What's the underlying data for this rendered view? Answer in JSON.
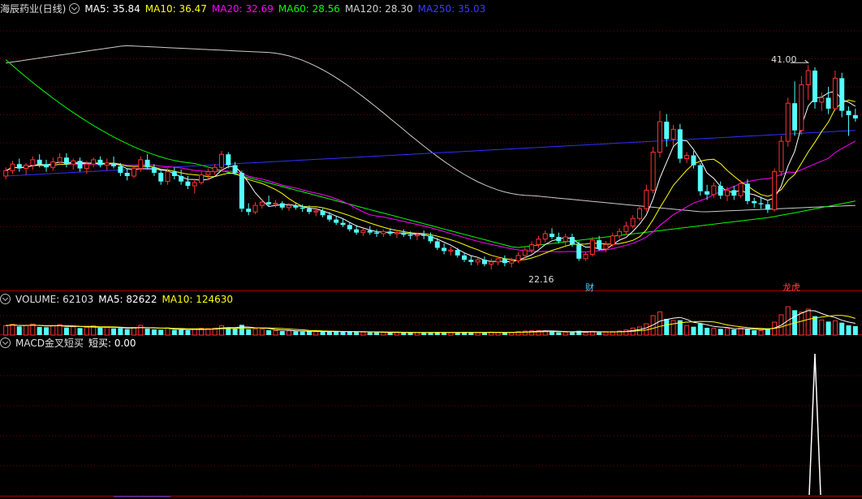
{
  "header": {
    "title": "海辰药业(日线)",
    "ma5": "MA5: 35.84",
    "ma10": "MA10: 36.47",
    "ma20": "MA20: 32.69",
    "ma60": "MA60: 28.56",
    "ma120": "MA120: 28.30",
    "ma250": "MA250: 35.03"
  },
  "volume_header": {
    "title": "VOLUME: 62103",
    "ma5": "MA5: 82622",
    "ma10": "MA10: 124630"
  },
  "macd_header": {
    "title": "MACD金叉短买",
    "value": "短买: 0.00"
  },
  "annotations": {
    "max_price": "41.00",
    "min_price": "22.16",
    "cai": "财",
    "long_hu": "龙虎"
  },
  "colors": {
    "up": "#ff3232",
    "down": "#54ffff",
    "ma5": "#ffffff",
    "ma10": "#ffff00",
    "ma20": "#ff00ff",
    "ma60": "#00ff00",
    "ma120": "#cccccc",
    "ma250": "#3030ff",
    "grid": "#7a0000"
  },
  "chart_data": {
    "type": "candlestick",
    "ylim": [
      20.5,
      45.5
    ],
    "max_price": 41.0,
    "min_price": 22.16,
    "ohlc": [
      [
        30.8,
        31.6,
        30.5,
        31.3
      ],
      [
        31.3,
        32.2,
        31.0,
        31.9
      ],
      [
        31.9,
        32.4,
        31.2,
        31.5
      ],
      [
        31.5,
        32.0,
        30.9,
        31.8
      ],
      [
        31.8,
        32.6,
        31.4,
        32.3
      ],
      [
        32.3,
        32.8,
        31.6,
        31.9
      ],
      [
        31.9,
        32.3,
        31.2,
        31.6
      ],
      [
        31.6,
        32.5,
        31.3,
        32.1
      ],
      [
        32.1,
        32.9,
        31.8,
        32.5
      ],
      [
        32.5,
        32.9,
        31.6,
        31.9
      ],
      [
        31.9,
        32.4,
        31.4,
        32.2
      ],
      [
        32.2,
        32.5,
        31.2,
        31.5
      ],
      [
        31.5,
        32.2,
        31.0,
        31.9
      ],
      [
        31.9,
        32.5,
        31.6,
        32.3
      ],
      [
        32.3,
        32.6,
        31.6,
        31.8
      ],
      [
        31.8,
        32.4,
        31.3,
        32.0
      ],
      [
        32.0,
        32.6,
        31.5,
        31.7
      ],
      [
        31.7,
        32.0,
        30.8,
        31.1
      ],
      [
        31.1,
        31.5,
        30.4,
        30.8
      ],
      [
        30.8,
        31.8,
        30.6,
        31.5
      ],
      [
        31.5,
        32.6,
        31.2,
        32.3
      ],
      [
        32.3,
        32.8,
        31.4,
        31.6
      ],
      [
        31.6,
        31.9,
        30.8,
        31.1
      ],
      [
        31.1,
        31.4,
        30.0,
        30.3
      ],
      [
        30.3,
        31.5,
        30.0,
        31.2
      ],
      [
        31.2,
        31.6,
        30.5,
        30.8
      ],
      [
        30.8,
        31.4,
        30.0,
        30.3
      ],
      [
        30.3,
        30.8,
        29.6,
        29.9
      ],
      [
        29.9,
        30.5,
        29.2,
        30.2
      ],
      [
        30.2,
        31.2,
        30.0,
        30.9
      ],
      [
        30.9,
        31.5,
        30.4,
        31.2
      ],
      [
        31.2,
        31.9,
        30.9,
        31.6
      ],
      [
        31.6,
        33.1,
        31.3,
        32.8
      ],
      [
        32.8,
        33.0,
        31.5,
        31.8
      ],
      [
        31.8,
        32.1,
        30.9,
        31.1
      ],
      [
        31.1,
        31.3,
        27.5,
        27.8
      ],
      [
        27.8,
        28.3,
        27.2,
        27.5
      ],
      [
        27.5,
        28.4,
        27.3,
        28.1
      ],
      [
        28.1,
        28.7,
        27.8,
        28.4
      ],
      [
        28.4,
        29.0,
        28.0,
        28.2
      ],
      [
        28.2,
        28.6,
        27.9,
        28.3
      ],
      [
        28.3,
        28.5,
        27.7,
        27.9
      ],
      [
        27.9,
        28.3,
        27.6,
        28.1
      ],
      [
        28.1,
        28.3,
        27.7,
        27.9
      ],
      [
        27.9,
        28.2,
        27.5,
        27.8
      ],
      [
        27.8,
        28.1,
        27.3,
        27.5
      ],
      [
        27.5,
        27.9,
        27.1,
        27.6
      ],
      [
        27.6,
        27.8,
        27.0,
        27.2
      ],
      [
        27.2,
        27.5,
        26.6,
        26.8
      ],
      [
        26.8,
        27.1,
        26.3,
        26.5
      ],
      [
        26.5,
        26.9,
        26.1,
        26.3
      ],
      [
        26.3,
        26.6,
        25.7,
        25.9
      ],
      [
        25.9,
        26.3,
        25.4,
        25.6
      ],
      [
        25.6,
        26.0,
        25.3,
        25.8
      ],
      [
        25.8,
        26.2,
        25.4,
        25.6
      ],
      [
        25.6,
        25.9,
        25.2,
        25.5
      ],
      [
        25.5,
        25.9,
        25.2,
        25.7
      ],
      [
        25.7,
        26.0,
        25.3,
        25.5
      ],
      [
        25.5,
        25.8,
        25.1,
        25.6
      ],
      [
        25.6,
        25.9,
        25.2,
        25.4
      ],
      [
        25.4,
        25.7,
        25.0,
        25.3
      ],
      [
        25.3,
        25.6,
        24.9,
        25.4
      ],
      [
        25.4,
        25.8,
        25.0,
        25.3
      ],
      [
        25.3,
        25.6,
        24.6,
        24.8
      ],
      [
        24.8,
        25.1,
        24.0,
        24.2
      ],
      [
        24.2,
        24.6,
        23.6,
        23.9
      ],
      [
        23.9,
        24.3,
        23.5,
        24.0
      ],
      [
        24.0,
        24.2,
        23.3,
        23.5
      ],
      [
        23.5,
        23.8,
        22.9,
        23.1
      ],
      [
        23.1,
        23.5,
        22.6,
        22.9
      ],
      [
        22.9,
        23.3,
        22.6,
        23.1
      ],
      [
        23.1,
        23.4,
        22.5,
        22.7
      ],
      [
        22.7,
        23.2,
        22.2,
        22.9
      ],
      [
        22.9,
        23.4,
        22.6,
        23.2
      ],
      [
        23.2,
        23.5,
        22.5,
        22.8
      ],
      [
        22.8,
        23.3,
        22.4,
        23.0
      ],
      [
        23.0,
        23.8,
        22.8,
        23.5
      ],
      [
        23.5,
        24.3,
        23.2,
        24.0
      ],
      [
        24.0,
        24.8,
        23.7,
        24.5
      ],
      [
        24.5,
        25.3,
        24.2,
        25.0
      ],
      [
        25.0,
        25.8,
        24.7,
        25.5
      ],
      [
        25.5,
        26.0,
        25.0,
        25.2
      ],
      [
        25.2,
        25.6,
        24.6,
        24.8
      ],
      [
        24.8,
        25.5,
        24.4,
        25.2
      ],
      [
        25.2,
        25.5,
        24.3,
        24.5
      ],
      [
        24.5,
        24.8,
        23.0,
        23.2
      ],
      [
        23.2,
        23.8,
        23.0,
        23.6
      ],
      [
        23.6,
        25.2,
        23.4,
        24.9
      ],
      [
        24.9,
        25.3,
        23.9,
        24.1
      ],
      [
        24.1,
        24.8,
        23.8,
        24.5
      ],
      [
        24.5,
        25.6,
        24.3,
        25.3
      ],
      [
        25.3,
        26.0,
        25.0,
        25.7
      ],
      [
        25.7,
        26.6,
        25.4,
        26.2
      ],
      [
        26.2,
        27.2,
        26.0,
        26.9
      ],
      [
        26.9,
        28.1,
        26.7,
        27.8
      ],
      [
        27.8,
        30.0,
        27.5,
        29.5
      ],
      [
        29.5,
        33.5,
        29.2,
        33.0
      ],
      [
        33.0,
        36.8,
        32.5,
        35.8
      ],
      [
        35.8,
        36.5,
        33.5,
        34.2
      ],
      [
        34.2,
        35.5,
        33.6,
        35.1
      ],
      [
        35.1,
        35.6,
        32.0,
        32.4
      ],
      [
        32.4,
        33.0,
        32.0,
        32.7
      ],
      [
        32.7,
        33.1,
        31.5,
        31.8
      ],
      [
        31.8,
        32.0,
        29.0,
        29.4
      ],
      [
        29.4,
        30.0,
        28.6,
        29.1
      ],
      [
        29.1,
        30.2,
        28.8,
        29.9
      ],
      [
        29.9,
        30.3,
        28.7,
        29.0
      ],
      [
        29.0,
        29.8,
        28.5,
        29.5
      ],
      [
        29.5,
        29.9,
        28.6,
        29.0
      ],
      [
        29.0,
        30.4,
        28.8,
        30.1
      ],
      [
        30.1,
        30.5,
        28.2,
        28.5
      ],
      [
        28.5,
        28.8,
        27.9,
        28.3
      ],
      [
        28.3,
        28.9,
        27.8,
        28.2
      ],
      [
        28.2,
        28.6,
        27.4,
        27.7
      ],
      [
        27.7,
        31.5,
        27.5,
        31.2
      ],
      [
        31.2,
        34.5,
        30.8,
        34.0
      ],
      [
        34.0,
        38.0,
        33.5,
        37.5
      ],
      [
        37.5,
        39.5,
        34.5,
        35.0
      ],
      [
        35.0,
        40.0,
        34.6,
        39.2
      ],
      [
        39.2,
        41.0,
        37.8,
        40.5
      ],
      [
        40.5,
        40.8,
        37.0,
        37.6
      ],
      [
        37.6,
        38.5,
        36.8,
        38.0
      ],
      [
        38.0,
        39.0,
        36.5,
        37.0
      ],
      [
        37.0,
        40.5,
        36.8,
        39.8
      ],
      [
        39.8,
        40.3,
        36.2,
        36.8
      ],
      [
        36.8,
        37.2,
        34.5,
        36.4
      ],
      [
        36.4,
        37.0,
        35.8,
        36.1
      ]
    ],
    "volume": [
      [
        3.5,
        1
      ],
      [
        4.0,
        1
      ],
      [
        3.2,
        0
      ],
      [
        3.6,
        1
      ],
      [
        4.1,
        1
      ],
      [
        3.0,
        0
      ],
      [
        2.9,
        0
      ],
      [
        3.5,
        1
      ],
      [
        3.9,
        1
      ],
      [
        2.8,
        0
      ],
      [
        3.1,
        1
      ],
      [
        2.6,
        0
      ],
      [
        2.9,
        1
      ],
      [
        3.4,
        1
      ],
      [
        2.7,
        0
      ],
      [
        2.9,
        1
      ],
      [
        2.5,
        0
      ],
      [
        2.6,
        0
      ],
      [
        2.2,
        0
      ],
      [
        2.8,
        1
      ],
      [
        3.6,
        1
      ],
      [
        2.4,
        0
      ],
      [
        2.1,
        0
      ],
      [
        2.0,
        0
      ],
      [
        2.7,
        1
      ],
      [
        1.9,
        0
      ],
      [
        2.0,
        0
      ],
      [
        1.8,
        0
      ],
      [
        2.2,
        1
      ],
      [
        2.5,
        1
      ],
      [
        2.4,
        1
      ],
      [
        2.6,
        1
      ],
      [
        3.5,
        1
      ],
      [
        2.8,
        0
      ],
      [
        2.5,
        0
      ],
      [
        3.8,
        0
      ],
      [
        2.2,
        0
      ],
      [
        2.3,
        1
      ],
      [
        2.2,
        1
      ],
      [
        1.8,
        0
      ],
      [
        1.7,
        1
      ],
      [
        1.5,
        0
      ],
      [
        1.6,
        1
      ],
      [
        1.4,
        0
      ],
      [
        1.3,
        0
      ],
      [
        1.4,
        0
      ],
      [
        1.3,
        1
      ],
      [
        1.2,
        0
      ],
      [
        1.4,
        0
      ],
      [
        1.3,
        0
      ],
      [
        1.2,
        0
      ],
      [
        1.3,
        0
      ],
      [
        1.2,
        0
      ],
      [
        1.1,
        1
      ],
      [
        1.0,
        0
      ],
      [
        1.0,
        0
      ],
      [
        1.0,
        1
      ],
      [
        0.9,
        0
      ],
      [
        1.0,
        1
      ],
      [
        0.9,
        0
      ],
      [
        0.9,
        0
      ],
      [
        0.9,
        1
      ],
      [
        0.9,
        0
      ],
      [
        1.0,
        0
      ],
      [
        1.1,
        0
      ],
      [
        1.0,
        0
      ],
      [
        0.9,
        1
      ],
      [
        1.0,
        0
      ],
      [
        1.1,
        0
      ],
      [
        1.0,
        0
      ],
      [
        0.9,
        1
      ],
      [
        1.0,
        0
      ],
      [
        1.1,
        1
      ],
      [
        1.0,
        1
      ],
      [
        0.9,
        0
      ],
      [
        1.0,
        1
      ],
      [
        1.3,
        1
      ],
      [
        1.5,
        1
      ],
      [
        1.6,
        1
      ],
      [
        1.7,
        1
      ],
      [
        1.6,
        1
      ],
      [
        1.2,
        0
      ],
      [
        1.0,
        0
      ],
      [
        1.1,
        1
      ],
      [
        1.0,
        0
      ],
      [
        1.6,
        0
      ],
      [
        1.0,
        1
      ],
      [
        1.4,
        1
      ],
      [
        1.0,
        0
      ],
      [
        1.1,
        1
      ],
      [
        1.3,
        1
      ],
      [
        1.5,
        1
      ],
      [
        1.9,
        1
      ],
      [
        2.6,
        1
      ],
      [
        3.0,
        1
      ],
      [
        4.2,
        1
      ],
      [
        7.2,
        1
      ],
      [
        8.6,
        1
      ],
      [
        6.0,
        0
      ],
      [
        5.4,
        1
      ],
      [
        5.5,
        0
      ],
      [
        3.5,
        1
      ],
      [
        3.1,
        0
      ],
      [
        4.2,
        0
      ],
      [
        2.7,
        0
      ],
      [
        2.5,
        1
      ],
      [
        2.3,
        0
      ],
      [
        2.4,
        1
      ],
      [
        2.1,
        0
      ],
      [
        2.6,
        1
      ],
      [
        2.2,
        0
      ],
      [
        1.8,
        0
      ],
      [
        1.7,
        1
      ],
      [
        2.5,
        0
      ],
      [
        4.8,
        1
      ],
      [
        7.5,
        1
      ],
      [
        10.5,
        1
      ],
      [
        9.2,
        0
      ],
      [
        8.5,
        1
      ],
      [
        9.6,
        1
      ],
      [
        7.0,
        0
      ],
      [
        5.6,
        1
      ],
      [
        5.0,
        0
      ],
      [
        5.3,
        1
      ],
      [
        4.6,
        0
      ],
      [
        3.6,
        0
      ],
      [
        3.3,
        0
      ]
    ],
    "ma250_endpoints": [
      30.8,
      35.0
    ],
    "macd_signal_index": 120
  }
}
